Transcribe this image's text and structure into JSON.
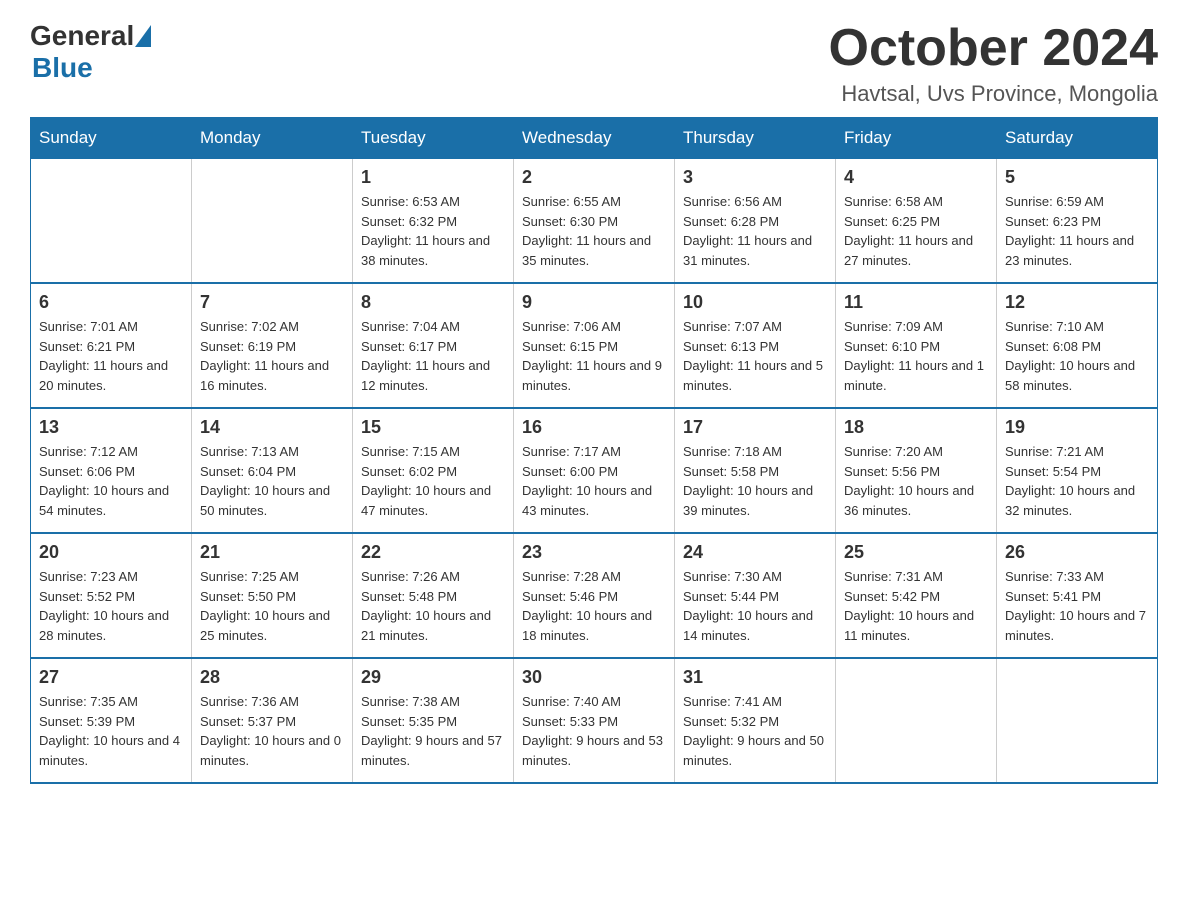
{
  "header": {
    "logo_general": "General",
    "logo_blue": "Blue",
    "month_title": "October 2024",
    "location": "Havtsal, Uvs Province, Mongolia"
  },
  "weekdays": [
    "Sunday",
    "Monday",
    "Tuesday",
    "Wednesday",
    "Thursday",
    "Friday",
    "Saturday"
  ],
  "weeks": [
    [
      {
        "day": "",
        "info": ""
      },
      {
        "day": "",
        "info": ""
      },
      {
        "day": "1",
        "info": "Sunrise: 6:53 AM\nSunset: 6:32 PM\nDaylight: 11 hours\nand 38 minutes."
      },
      {
        "day": "2",
        "info": "Sunrise: 6:55 AM\nSunset: 6:30 PM\nDaylight: 11 hours\nand 35 minutes."
      },
      {
        "day": "3",
        "info": "Sunrise: 6:56 AM\nSunset: 6:28 PM\nDaylight: 11 hours\nand 31 minutes."
      },
      {
        "day": "4",
        "info": "Sunrise: 6:58 AM\nSunset: 6:25 PM\nDaylight: 11 hours\nand 27 minutes."
      },
      {
        "day": "5",
        "info": "Sunrise: 6:59 AM\nSunset: 6:23 PM\nDaylight: 11 hours\nand 23 minutes."
      }
    ],
    [
      {
        "day": "6",
        "info": "Sunrise: 7:01 AM\nSunset: 6:21 PM\nDaylight: 11 hours\nand 20 minutes."
      },
      {
        "day": "7",
        "info": "Sunrise: 7:02 AM\nSunset: 6:19 PM\nDaylight: 11 hours\nand 16 minutes."
      },
      {
        "day": "8",
        "info": "Sunrise: 7:04 AM\nSunset: 6:17 PM\nDaylight: 11 hours\nand 12 minutes."
      },
      {
        "day": "9",
        "info": "Sunrise: 7:06 AM\nSunset: 6:15 PM\nDaylight: 11 hours\nand 9 minutes."
      },
      {
        "day": "10",
        "info": "Sunrise: 7:07 AM\nSunset: 6:13 PM\nDaylight: 11 hours\nand 5 minutes."
      },
      {
        "day": "11",
        "info": "Sunrise: 7:09 AM\nSunset: 6:10 PM\nDaylight: 11 hours\nand 1 minute."
      },
      {
        "day": "12",
        "info": "Sunrise: 7:10 AM\nSunset: 6:08 PM\nDaylight: 10 hours\nand 58 minutes."
      }
    ],
    [
      {
        "day": "13",
        "info": "Sunrise: 7:12 AM\nSunset: 6:06 PM\nDaylight: 10 hours\nand 54 minutes."
      },
      {
        "day": "14",
        "info": "Sunrise: 7:13 AM\nSunset: 6:04 PM\nDaylight: 10 hours\nand 50 minutes."
      },
      {
        "day": "15",
        "info": "Sunrise: 7:15 AM\nSunset: 6:02 PM\nDaylight: 10 hours\nand 47 minutes."
      },
      {
        "day": "16",
        "info": "Sunrise: 7:17 AM\nSunset: 6:00 PM\nDaylight: 10 hours\nand 43 minutes."
      },
      {
        "day": "17",
        "info": "Sunrise: 7:18 AM\nSunset: 5:58 PM\nDaylight: 10 hours\nand 39 minutes."
      },
      {
        "day": "18",
        "info": "Sunrise: 7:20 AM\nSunset: 5:56 PM\nDaylight: 10 hours\nand 36 minutes."
      },
      {
        "day": "19",
        "info": "Sunrise: 7:21 AM\nSunset: 5:54 PM\nDaylight: 10 hours\nand 32 minutes."
      }
    ],
    [
      {
        "day": "20",
        "info": "Sunrise: 7:23 AM\nSunset: 5:52 PM\nDaylight: 10 hours\nand 28 minutes."
      },
      {
        "day": "21",
        "info": "Sunrise: 7:25 AM\nSunset: 5:50 PM\nDaylight: 10 hours\nand 25 minutes."
      },
      {
        "day": "22",
        "info": "Sunrise: 7:26 AM\nSunset: 5:48 PM\nDaylight: 10 hours\nand 21 minutes."
      },
      {
        "day": "23",
        "info": "Sunrise: 7:28 AM\nSunset: 5:46 PM\nDaylight: 10 hours\nand 18 minutes."
      },
      {
        "day": "24",
        "info": "Sunrise: 7:30 AM\nSunset: 5:44 PM\nDaylight: 10 hours\nand 14 minutes."
      },
      {
        "day": "25",
        "info": "Sunrise: 7:31 AM\nSunset: 5:42 PM\nDaylight: 10 hours\nand 11 minutes."
      },
      {
        "day": "26",
        "info": "Sunrise: 7:33 AM\nSunset: 5:41 PM\nDaylight: 10 hours\nand 7 minutes."
      }
    ],
    [
      {
        "day": "27",
        "info": "Sunrise: 7:35 AM\nSunset: 5:39 PM\nDaylight: 10 hours\nand 4 minutes."
      },
      {
        "day": "28",
        "info": "Sunrise: 7:36 AM\nSunset: 5:37 PM\nDaylight: 10 hours\nand 0 minutes."
      },
      {
        "day": "29",
        "info": "Sunrise: 7:38 AM\nSunset: 5:35 PM\nDaylight: 9 hours\nand 57 minutes."
      },
      {
        "day": "30",
        "info": "Sunrise: 7:40 AM\nSunset: 5:33 PM\nDaylight: 9 hours\nand 53 minutes."
      },
      {
        "day": "31",
        "info": "Sunrise: 7:41 AM\nSunset: 5:32 PM\nDaylight: 9 hours\nand 50 minutes."
      },
      {
        "day": "",
        "info": ""
      },
      {
        "day": "",
        "info": ""
      }
    ]
  ]
}
